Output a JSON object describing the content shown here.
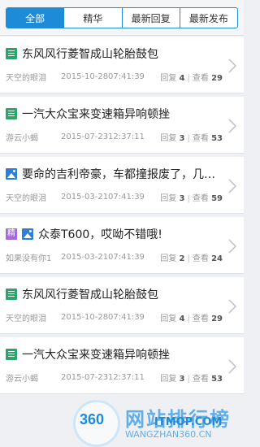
{
  "tabs": [
    {
      "label": "全部",
      "active": true
    },
    {
      "label": "精华",
      "active": false
    },
    {
      "label": "最新回复",
      "active": false
    },
    {
      "label": "最新发布",
      "active": false
    }
  ],
  "threads": [
    {
      "icon": "doc-icon",
      "title": "东风风行菱智成山轮胎鼓包",
      "author": "天空的眼泪",
      "date": "2015-10-28",
      "time": "07:41:39",
      "reply_label": "回复",
      "replies": "4",
      "view_label": "查看",
      "views": "29"
    },
    {
      "icon": "doc-icon",
      "title": "一汽大众宝来变速箱异响顿挫",
      "author": "游云小蝎",
      "date": "2015-07-23",
      "time": "12:37:11",
      "reply_label": "回复",
      "replies": "3",
      "view_label": "查看",
      "views": "53"
    },
    {
      "icon": "image-icon",
      "title": "要命的吉利帝豪，车都撞报废了，几个…",
      "author": "天空的眼泪",
      "date": "2015-03-21",
      "time": "07:41:39",
      "reply_label": "回复",
      "replies": "3",
      "view_label": "查看",
      "views": "59"
    },
    {
      "icon": "jing-icon",
      "badge": "精",
      "icon2": "image-icon",
      "title": "众泰T600，哎呦不错哦!",
      "author": "如果没有你1",
      "date": "2015-03-21",
      "time": "07:41:39",
      "reply_label": "回复",
      "replies": "2",
      "view_label": "查看",
      "views": "24"
    },
    {
      "icon": "doc-icon",
      "title": "东风风行菱智成山轮胎鼓包",
      "author": "天空的眼泪",
      "date": "2015-10-28",
      "time": "07:41:39",
      "reply_label": "回复",
      "replies": "4",
      "view_label": "查看",
      "views": "29"
    },
    {
      "icon": "doc-icon",
      "title": "一汽大众宝来变速箱异响顿挫",
      "author": "游云小蝎",
      "date": "2015-07-23",
      "time": "12:37:11",
      "reply_label": "回复",
      "replies": "3",
      "view_label": "查看",
      "views": "53"
    }
  ],
  "watermark": {
    "logo": "360",
    "text": "网站排行榜",
    "site": "ITMOP.COM",
    "url": "WANGZHAN360.CN"
  },
  "colors": {
    "accent": "#1e8bd8",
    "doc_icon": "#2aa66d",
    "image_icon": "#2f7fd6",
    "jing_badge": "#a26ad9"
  }
}
